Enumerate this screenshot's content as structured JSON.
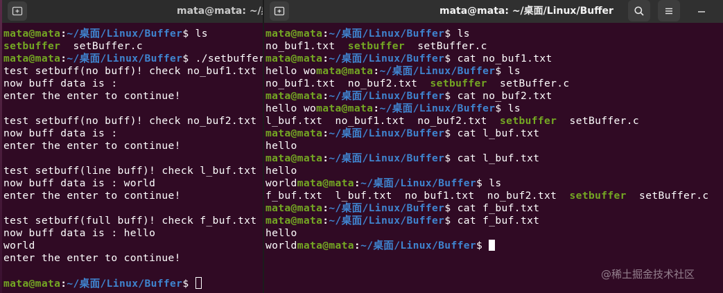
{
  "colors": {
    "background": "#300a24",
    "user_host": "#74a723",
    "path": "#3f84cf",
    "executable": "#74a723",
    "text": "#ffffff"
  },
  "left_window": {
    "title": "mata@mata: ~/桌面",
    "newtab_icon": "new-tab-icon",
    "lines": [
      [
        [
          "mata@mata",
          1
        ],
        [
          ":",
          3
        ],
        [
          "~/桌面/Linux/Buffer",
          2
        ],
        [
          "$ ls",
          0
        ]
      ],
      [
        [
          "setbuffer",
          4
        ],
        [
          "  setBuffer.c",
          0
        ]
      ],
      [
        [
          "mata@mata",
          1
        ],
        [
          ":",
          3
        ],
        [
          "~/桌面/Linux/Buffer",
          2
        ],
        [
          "$ ./setbuffer",
          0
        ]
      ],
      [
        [
          "test setbuff(no buff)! check no_buf1.txt",
          0
        ]
      ],
      [
        [
          "now buff data is :",
          0
        ]
      ],
      [
        [
          "enter the enter to continue!",
          0
        ]
      ],
      [
        [
          "",
          0
        ]
      ],
      [
        [
          "test setbuff(no buff)! check no_buf2.txt",
          0
        ]
      ],
      [
        [
          "now buff data is :",
          0
        ]
      ],
      [
        [
          "enter the enter to continue!",
          0
        ]
      ],
      [
        [
          "",
          0
        ]
      ],
      [
        [
          "test setbuff(line buff)! check l_buf.txt",
          0
        ]
      ],
      [
        [
          "now buff data is : world",
          0
        ]
      ],
      [
        [
          "enter the enter to continue!",
          0
        ]
      ],
      [
        [
          "",
          0
        ]
      ],
      [
        [
          "test setbuff(full buff)! check f_buf.txt",
          0
        ]
      ],
      [
        [
          "now buff data is : hello",
          0
        ]
      ],
      [
        [
          "world",
          0
        ]
      ],
      [
        [
          "enter the enter to continue!",
          0
        ]
      ],
      [
        [
          "",
          0
        ]
      ],
      [
        [
          "mata@mata",
          1
        ],
        [
          ":",
          3
        ],
        [
          "~/桌面/Linux/Buffer",
          2
        ],
        [
          "$ ",
          0
        ],
        [
          "",
          6
        ]
      ]
    ]
  },
  "right_window": {
    "title": "mata@mata: ~/桌面/Linux/Buffer",
    "newtab_icon": "new-tab-icon",
    "search_icon": "search-icon",
    "menu_icon": "hamburger-menu-icon",
    "minimize_icon": "minimize-icon",
    "lines": [
      [
        [
          "mata@mata",
          1
        ],
        [
          ":",
          3
        ],
        [
          "~/桌面/Linux/Buffer",
          2
        ],
        [
          "$ ls",
          0
        ]
      ],
      [
        [
          "no_buf1.txt  ",
          0
        ],
        [
          "setbuffer",
          4
        ],
        [
          "  setBuffer.c",
          0
        ]
      ],
      [
        [
          "mata@mata",
          1
        ],
        [
          ":",
          3
        ],
        [
          "~/桌面/Linux/Buffer",
          2
        ],
        [
          "$ cat no_buf1.txt",
          0
        ]
      ],
      [
        [
          "hello wo",
          0
        ],
        [
          "mata@mata",
          1
        ],
        [
          ":",
          3
        ],
        [
          "~/桌面/Linux/Buffer",
          2
        ],
        [
          "$ ls",
          0
        ]
      ],
      [
        [
          "no_buf1.txt  no_buf2.txt  ",
          0
        ],
        [
          "setbuffer",
          4
        ],
        [
          "  setBuffer.c",
          0
        ]
      ],
      [
        [
          "mata@mata",
          1
        ],
        [
          ":",
          3
        ],
        [
          "~/桌面/Linux/Buffer",
          2
        ],
        [
          "$ cat no_buf2.txt",
          0
        ]
      ],
      [
        [
          "hello wo",
          0
        ],
        [
          "mata@mata",
          1
        ],
        [
          ":",
          3
        ],
        [
          "~/桌面/Linux/Buffer",
          2
        ],
        [
          "$ ls",
          0
        ]
      ],
      [
        [
          "l_buf.txt  no_buf1.txt  no_buf2.txt  ",
          0
        ],
        [
          "setbuffer",
          4
        ],
        [
          "  setBuffer.c",
          0
        ]
      ],
      [
        [
          "mata@mata",
          1
        ],
        [
          ":",
          3
        ],
        [
          "~/桌面/Linux/Buffer",
          2
        ],
        [
          "$ cat l_buf.txt",
          0
        ]
      ],
      [
        [
          "hello",
          0
        ]
      ],
      [
        [
          "mata@mata",
          1
        ],
        [
          ":",
          3
        ],
        [
          "~/桌面/Linux/Buffer",
          2
        ],
        [
          "$ cat l_buf.txt",
          0
        ]
      ],
      [
        [
          "hello",
          0
        ]
      ],
      [
        [
          "world",
          0
        ],
        [
          "mata@mata",
          1
        ],
        [
          ":",
          3
        ],
        [
          "~/桌面/Linux/Buffer",
          2
        ],
        [
          "$ ls",
          0
        ]
      ],
      [
        [
          "f_buf.txt  l_buf.txt  no_buf1.txt  no_buf2.txt  ",
          0
        ],
        [
          "setbuffer",
          4
        ],
        [
          "  setBuffer.c",
          0
        ]
      ],
      [
        [
          "mata@mata",
          1
        ],
        [
          ":",
          3
        ],
        [
          "~/桌面/Linux/Buffer",
          2
        ],
        [
          "$ cat f_buf.txt",
          0
        ]
      ],
      [
        [
          "mata@mata",
          1
        ],
        [
          ":",
          3
        ],
        [
          "~/桌面/Linux/Buffer",
          2
        ],
        [
          "$ cat f_buf.txt",
          0
        ]
      ],
      [
        [
          "hello",
          0
        ]
      ],
      [
        [
          "world",
          0
        ],
        [
          "mata@mata",
          1
        ],
        [
          ":",
          3
        ],
        [
          "~/桌面/Linux/Buffer",
          2
        ],
        [
          "$ ",
          0
        ],
        [
          "",
          5
        ]
      ]
    ]
  },
  "watermark": "@稀土掘金技术社区"
}
